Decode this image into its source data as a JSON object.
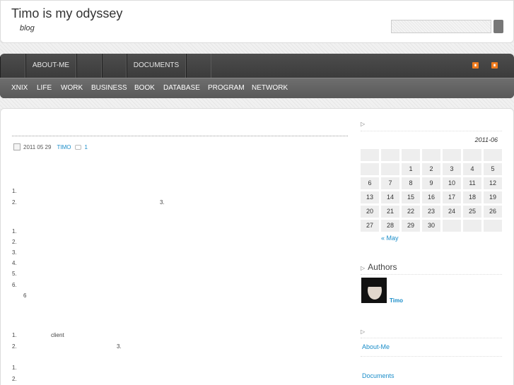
{
  "header": {
    "title": "Timo is my odyssey",
    "tagline": "blog",
    "search": {
      "value": "",
      "placeholder": ""
    }
  },
  "nav": {
    "top_items": [
      {
        "label": ""
      },
      {
        "label": "ABOUT-ME"
      },
      {
        "label": ""
      },
      {
        "label": ""
      },
      {
        "label": "DOCUMENTS"
      },
      {
        "label": ""
      }
    ],
    "categories": [
      {
        "label": "XNIX"
      },
      {
        "label": "LIFE"
      },
      {
        "label": "WORK"
      },
      {
        "label": "BUSINESS"
      },
      {
        "label": "BOOK"
      },
      {
        "label": "DATABASE"
      },
      {
        "label": "PROGRAM"
      },
      {
        "label": "NETWORK"
      }
    ],
    "rss_icons": [
      "rss-icon",
      "rss-icon"
    ]
  },
  "post": {
    "date": "2011 05 29",
    "author": "TIMO",
    "comments": "1",
    "lines": [
      {
        "num": "1.",
        "text": ""
      },
      {
        "num": "2.",
        "text": "3."
      },
      {
        "num": "1.",
        "text": ""
      },
      {
        "num": "2.",
        "text": ""
      },
      {
        "num": "3.",
        "text": ""
      },
      {
        "num": "4.",
        "text": ""
      },
      {
        "num": "5.",
        "text": ""
      },
      {
        "num": "6.",
        "text": ""
      },
      {
        "num": "",
        "text": "6"
      },
      {
        "num": "1.",
        "text": "client"
      },
      {
        "num": "2.",
        "text": "3."
      },
      {
        "num": "1.",
        "text": ""
      },
      {
        "num": "2.",
        "text": ""
      }
    ]
  },
  "sidebar": {
    "calendar": {
      "caption": "2011-06",
      "prev_link": "« May",
      "weeks": [
        [
          "",
          "",
          "",
          "",
          "",
          "",
          ""
        ],
        [
          "",
          "",
          "1",
          "2",
          "3",
          "4",
          "5"
        ],
        [
          "6",
          "7",
          "8",
          "9",
          "10",
          "11",
          "12"
        ],
        [
          "13",
          "14",
          "15",
          "16",
          "17",
          "18",
          "19"
        ],
        [
          "20",
          "21",
          "22",
          "23",
          "24",
          "25",
          "26"
        ],
        [
          "27",
          "28",
          "29",
          "30",
          "",
          "",
          ""
        ]
      ]
    },
    "authors": {
      "title": "Authors",
      "name": "Timo"
    },
    "pages": {
      "title": "",
      "links": [
        "About-Me",
        "Documents"
      ]
    }
  }
}
